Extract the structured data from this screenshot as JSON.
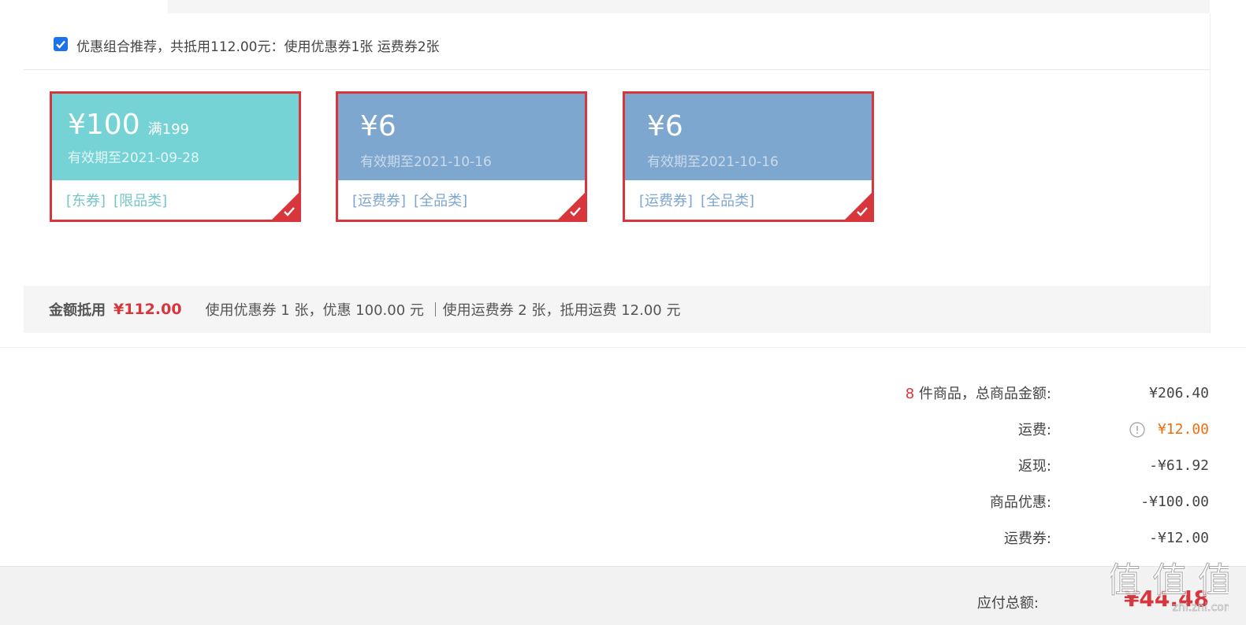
{
  "recommend": {
    "checked": true,
    "text": "优惠组合推荐，共抵用112.00元：使用优惠券1张 运费券2张"
  },
  "coupons": [
    {
      "amount": "¥100",
      "condition": "满199",
      "expiry": "有效期至2021-09-28",
      "tags": [
        "[东券]",
        "[限品类]"
      ],
      "color": "#76d3d5",
      "selected": true
    },
    {
      "amount": "¥6",
      "condition": "",
      "expiry": "有效期至2021-10-16",
      "tags": [
        "[运费券]",
        "[全品类]"
      ],
      "color": "#7ea7cf",
      "selected": true
    },
    {
      "amount": "¥6",
      "condition": "",
      "expiry": "有效期至2021-10-16",
      "tags": [
        "[运费券]",
        "[全品类]"
      ],
      "color": "#7ea7cf",
      "selected": true
    }
  ],
  "summary": {
    "label": "金额抵用",
    "amount": "¥112.00",
    "detail": "使用优惠券 1 张，优惠 100.00 元 ｜使用运费券 2 张，抵用运费 12.00 元"
  },
  "totals": {
    "count": "8",
    "goods_label": " 件商品，总商品金额:",
    "goods_value": "¥206.40",
    "shipping_label": "运费:",
    "shipping_value": "¥12.00",
    "cashback_label": "返现:",
    "cashback_value": "-¥61.92",
    "discount_label": "商品优惠:",
    "discount_value": "-¥100.00",
    "shipping_coupon_label": "运费券:",
    "shipping_coupon_value": "-¥12.00"
  },
  "payable": {
    "label": "应付总额:",
    "value": "¥44.48"
  },
  "watermark": {
    "text": "值 值 值",
    "sub": "zhi.zhi.com"
  },
  "colors": {
    "accent_red": "#d8363d",
    "orange": "#f26c0c",
    "teal": "#76d3d5",
    "blue": "#7ea7cf"
  }
}
